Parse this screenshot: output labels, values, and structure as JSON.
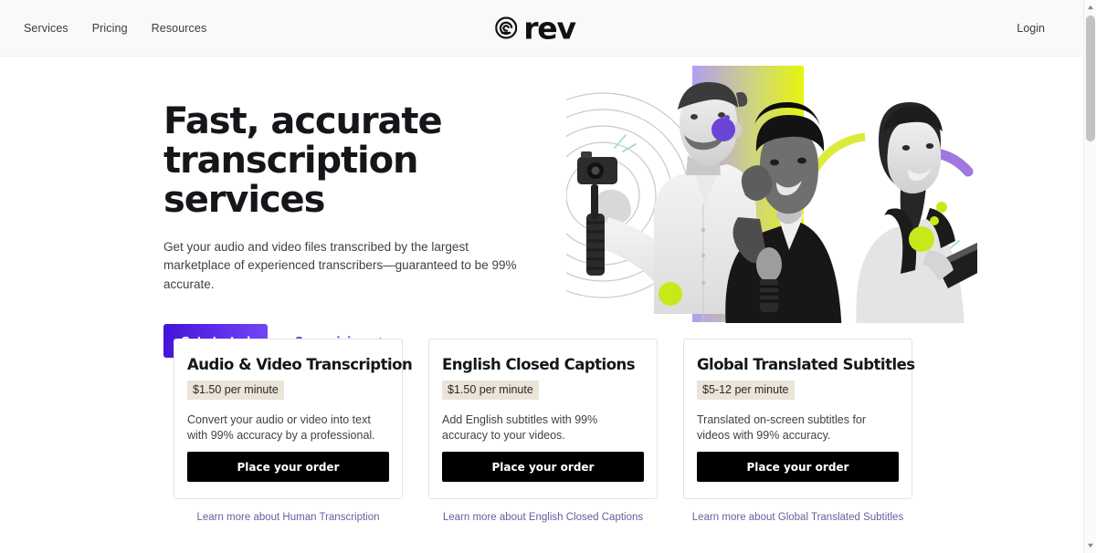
{
  "header": {
    "nav_items": [
      {
        "label": "Services"
      },
      {
        "label": "Pricing"
      },
      {
        "label": "Resources"
      }
    ],
    "logo_text": "rev",
    "logo_icon": "rev-swirl-icon",
    "login_label": "Login"
  },
  "hero": {
    "title": "Fast, accurate transcription services",
    "subtitle": "Get your audio and video files transcribed by the largest marketplace of experienced transcribers—guaranteed to be 99% accurate.",
    "primary_cta": "Get started",
    "secondary_cta": "See pricing",
    "secondary_cta_icon": "arrow-right-icon",
    "art_alt": "three people with camera, microphone and books",
    "colors": {
      "gradient_start": "#b29ef2",
      "gradient_end": "#e6f50c",
      "accent_purple": "#5c39d6",
      "accent_lime": "#c8e619",
      "button_gradient_start": "#4313d6",
      "button_gradient_end": "#7348f5"
    }
  },
  "cards": [
    {
      "title": "Audio & Video Transcription",
      "price": "$1.50 per minute",
      "description": "Convert your audio or video into text with 99% accuracy by a professional.",
      "button": "Place your order",
      "learn_more": "Learn more about Human Transcription"
    },
    {
      "title": "English Closed Captions",
      "price": "$1.50 per minute",
      "description": "Add English subtitles with 99% accuracy to your videos.",
      "button": "Place your order",
      "learn_more": "Learn more about English Closed Captions"
    },
    {
      "title": "Global Translated Subtitles",
      "price": "$5-12 per minute",
      "description": "Translated on-screen subtitles for videos with 99% accuracy.",
      "button": "Place your order",
      "learn_more": "Learn more about Global Translated Subtitles"
    }
  ],
  "scrollbar": {
    "up_icon": "scroll-up-arrow-icon",
    "down_icon": "scroll-down-arrow-icon"
  }
}
